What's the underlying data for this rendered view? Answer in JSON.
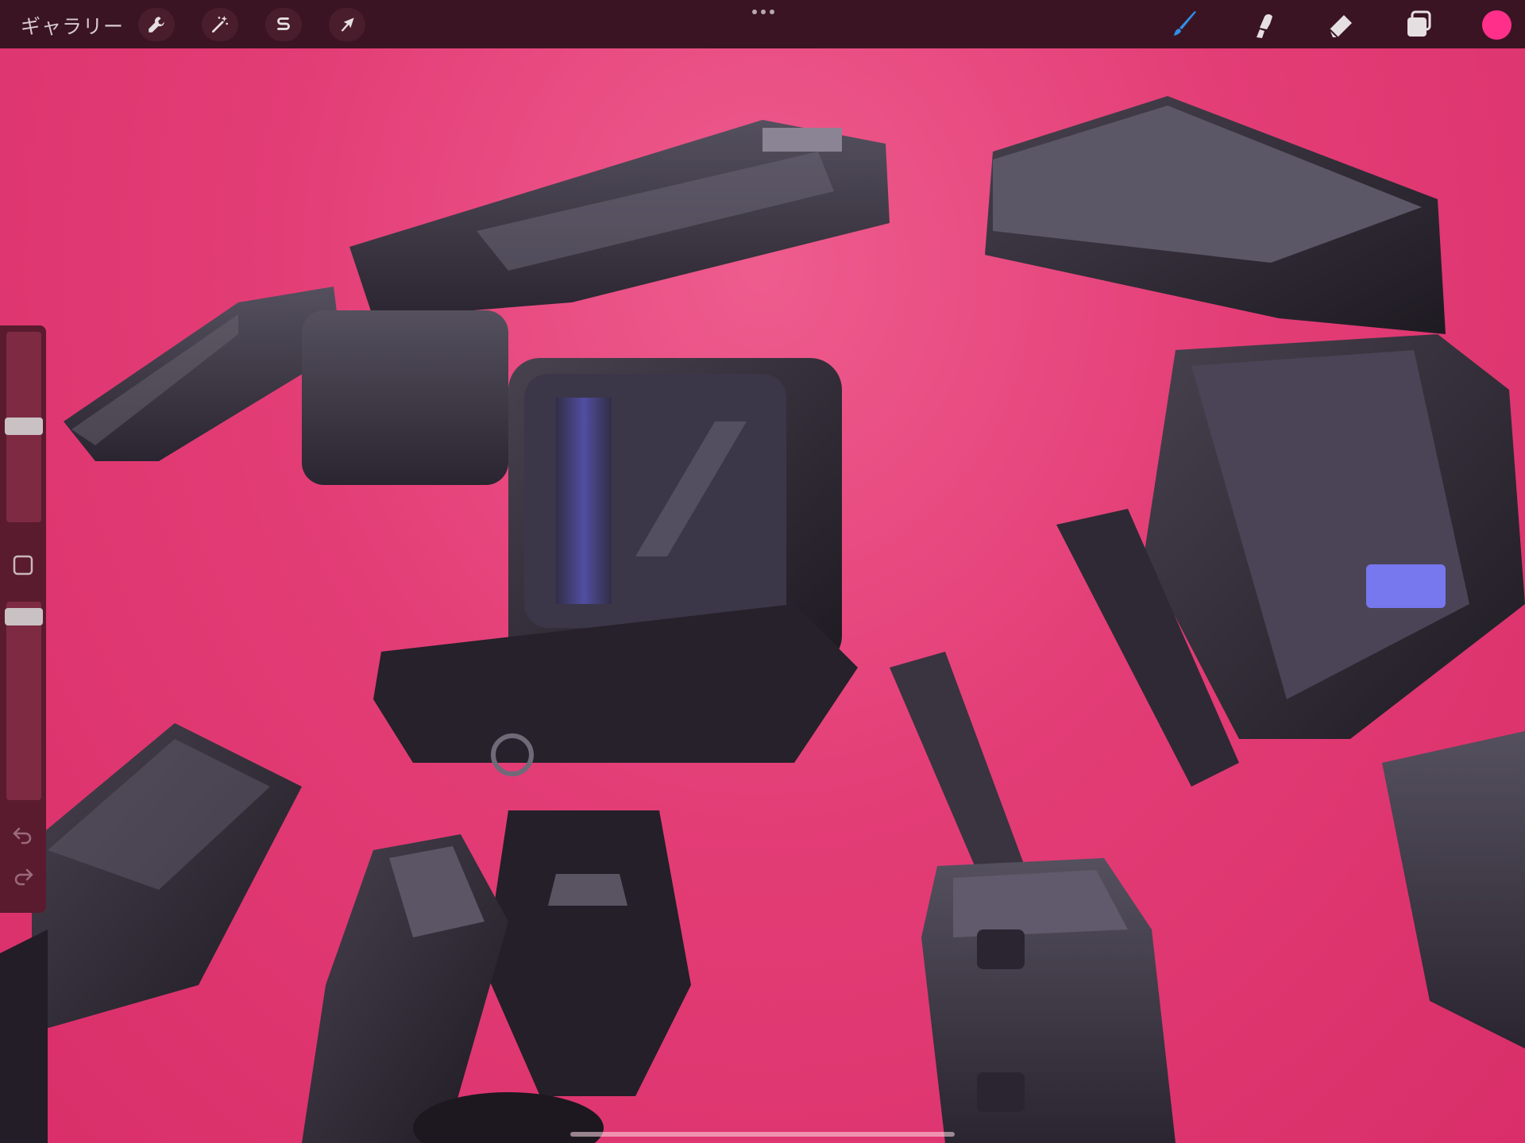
{
  "toolbar": {
    "gallery_label": "ギャラリー",
    "left_tools": [
      {
        "name": "actions",
        "icon": "wrench-icon"
      },
      {
        "name": "adjustments",
        "icon": "magic-wand-icon"
      },
      {
        "name": "selection",
        "icon": "selection-s-icon"
      },
      {
        "name": "transform",
        "icon": "arrow-cursor-icon"
      }
    ],
    "more_icon": "ellipsis-icon",
    "right_tools": [
      {
        "name": "brush",
        "icon": "brush-icon",
        "active": true
      },
      {
        "name": "smudge",
        "icon": "smudge-icon"
      },
      {
        "name": "eraser",
        "icon": "eraser-icon"
      },
      {
        "name": "layers",
        "icon": "layers-icon"
      }
    ],
    "current_color": "#ff2f8a"
  },
  "sidebar": {
    "brush_size_level": 0.5,
    "brush_opacity_level": 0.05,
    "modify_icon": "square-outline-icon",
    "undo_icon": "undo-arrow-icon",
    "redo_icon": "redo-arrow-icon"
  },
  "canvas": {
    "background_color": "#e23a78",
    "artwork_description_icon": "mech-robot-artwork"
  }
}
